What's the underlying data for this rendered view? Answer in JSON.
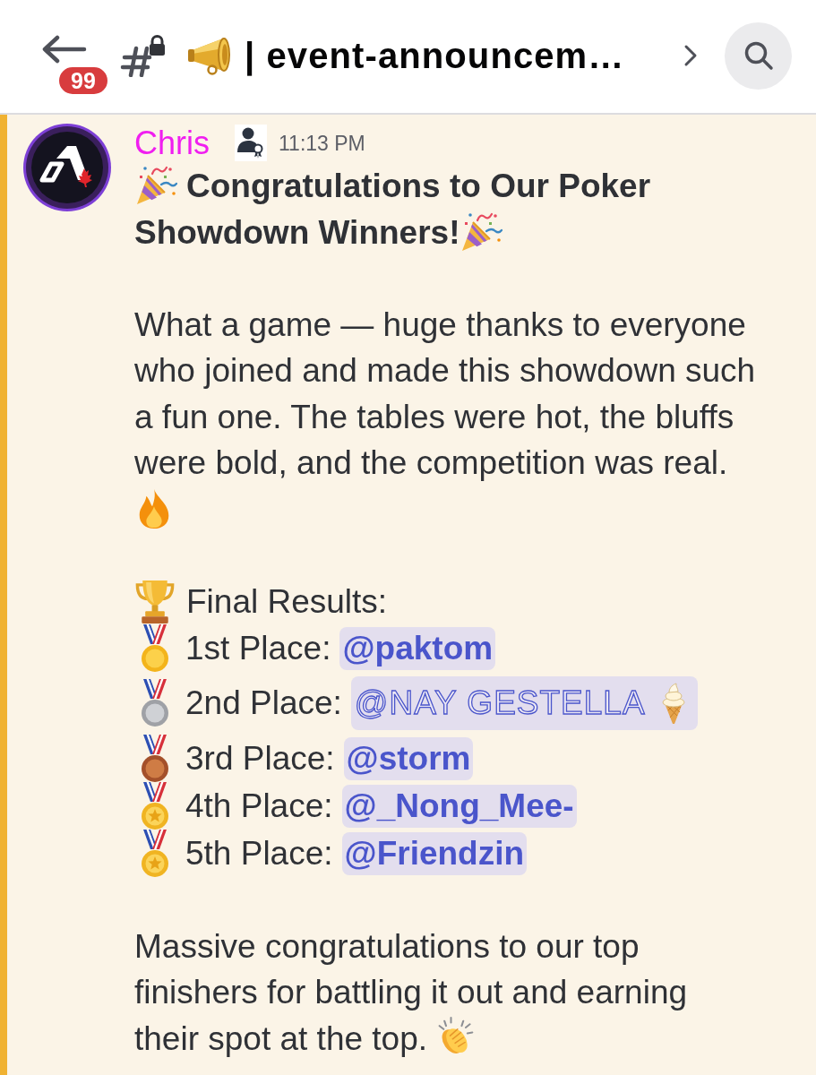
{
  "top_bar": {
    "unread_count": "99",
    "channel_name": "| event-announcem…"
  },
  "message": {
    "author": "Chris",
    "timestamp": "11:13 PM",
    "title": "Congratulations to Our Poker Showdown Winners!",
    "body": "What a game — huge thanks to everyone who joined and made this showdown such a fun one. The tables were hot, the bluffs were bold, and the competition was real.",
    "results_heading": "Final Results:",
    "results": [
      {
        "kind": "gold",
        "label": "1st Place:",
        "mention": {
          "kind": "plain",
          "text": "@paktom"
        }
      },
      {
        "kind": "silver",
        "label": "2nd Place:",
        "mention": {
          "kind": "decorated",
          "text": "@NAY GESTELLA"
        }
      },
      {
        "kind": "bronze",
        "label": "3rd Place:",
        "mention": {
          "kind": "plain",
          "text": "@storm"
        }
      },
      {
        "kind": "sports",
        "label": "4th Place:",
        "mention": {
          "kind": "plain",
          "text": "@_Nong_Mee-"
        }
      },
      {
        "kind": "sports",
        "label": "5th Place:",
        "mention": {
          "kind": "plain",
          "text": "@Friendzin"
        }
      }
    ],
    "closing": "Massive congratulations to our top finishers for battling it out and earning their spot at the top."
  }
}
